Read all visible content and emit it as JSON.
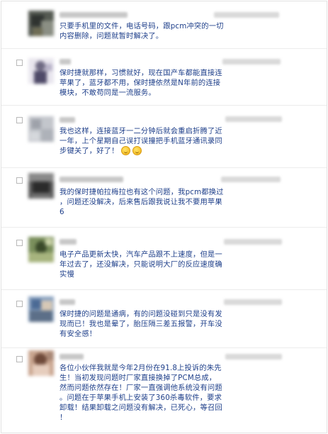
{
  "comments": [
    {
      "lines": [
        "只要手机里的文件，电话号码，跟pcm冲突的一切",
        "内容删除，问题就暂时解决了。"
      ],
      "emoji_count": 0
    },
    {
      "lines": [
        "保时捷就那样，习惯就好，现在国产车都能直接连",
        "苹果了，蓝牙都不用，保时捷依然是N年前的连接",
        "模块，不敢苟同是一流服务。"
      ],
      "emoji_count": 0
    },
    {
      "lines": [
        "我也这样，连接蓝牙一二分钟后就会重启折腾了近",
        "一年，上个星期自己误打误撞把手机蓝牙通讯录同",
        "步键关了，好了！"
      ],
      "emoji_count": 2
    },
    {
      "lines": [
        "我的保时捷帕拉梅拉也有这个问题，我pcm都换过",
        "，问题还没解决，后来售后跟我说让我不要用苹果",
        "6"
      ],
      "emoji_count": 0
    },
    {
      "lines": [
        "电子产品更新太快，汽车产品跟不上速度，但是一",
        "年过去了，还没解决，只能说明大厂的反应速度确",
        "实慢"
      ],
      "emoji_count": 0
    },
    {
      "lines": [
        "保时捷的问题是通病，有的问题没碰到只是没有发",
        "现而已！我也是晕了，胎压隔三差五报警，开车没",
        "有安全感！"
      ],
      "emoji_count": 0
    },
    {
      "lines": [
        "各位小伙伴我就是今年2月份在91.8上投诉的朱先",
        "生！当初发现问题时厂家直接换掉了PCM总成，",
        "然而问题依然存在！厂家一直强调他系统没有问题",
        "。问题在于苹果手机上安装了360杀毒软件，要求",
        "卸载！结果卸载之问题没有解决，已死心，等召回",
        "！"
      ],
      "emoji_count": 0
    }
  ]
}
